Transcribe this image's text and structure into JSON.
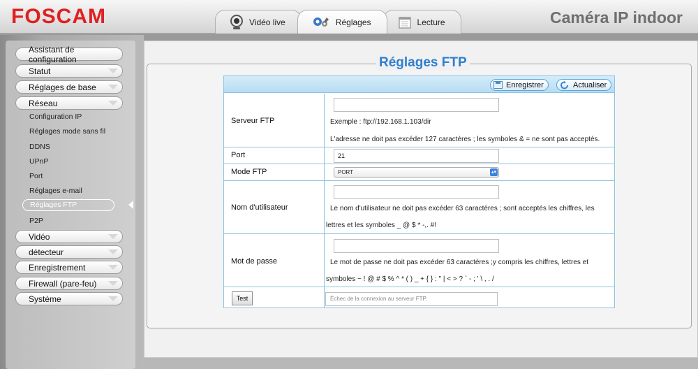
{
  "header": {
    "logo": "FOSCAM",
    "camera_title": "Caméra IP indoor",
    "tabs": [
      {
        "label": "Vidéo live",
        "icon": "webcam-icon"
      },
      {
        "label": "Réglages",
        "icon": "gears-icon"
      },
      {
        "label": "Lecture",
        "icon": "calendar-icon"
      }
    ]
  },
  "sidebar": {
    "menus": [
      {
        "label": "Assistant de configuration"
      },
      {
        "label": "Statut"
      },
      {
        "label": "Réglages de base"
      },
      {
        "label": "Réseau"
      },
      {
        "label": "Vidéo"
      },
      {
        "label": "détecteur"
      },
      {
        "label": "Enregistrement"
      },
      {
        "label": "Firewall (pare-feu)"
      },
      {
        "label": "Système"
      }
    ],
    "network_items": [
      "Configuration IP",
      "Réglages mode sans fil",
      "DDNS",
      "UPnP",
      "Port",
      "Réglages e-mail",
      "Réglages FTP",
      "P2P"
    ]
  },
  "main": {
    "title": "Réglages FTP",
    "toolbar": {
      "save_label": "Enregistrer",
      "refresh_label": "Actualiser"
    },
    "fields": {
      "ftp_server": {
        "label": "Serveur FTP",
        "value": "",
        "example": "Exemple : ftp://192.168.1.103/dir",
        "hint": "L'adresse ne doit pas excéder 127 caractères ; les symboles & = ne sont pas acceptés."
      },
      "port": {
        "label": "Port",
        "value": "21"
      },
      "ftp_mode": {
        "label": "Mode FTP",
        "value": "PORT"
      },
      "username": {
        "label": "Nom d'utilisateur",
        "value": "",
        "hint1": "Le nom d'utilisateur ne doit pas excéder 63 caractères ; sont acceptés les chiffres, les",
        "hint2": "lettres et les symboles _ @ $ * -,. #!"
      },
      "password": {
        "label": "Mot de passe",
        "value": "",
        "hint1": "Le mot de passe ne doit pas excéder 63 caractères ;y compris les chiffres, lettres et",
        "hint2": "symboles ~ ! @ # $ % ^ * ( ) _ + { } : \" | < > ? ` - ; ' \\ , . /"
      }
    },
    "test": {
      "button_label": "Test",
      "status": "Échec de la connexion au serveur FTP."
    }
  },
  "colors": {
    "logo": "#e02020",
    "title_blue": "#2f7fd0",
    "table_border": "#8ec3e3"
  }
}
